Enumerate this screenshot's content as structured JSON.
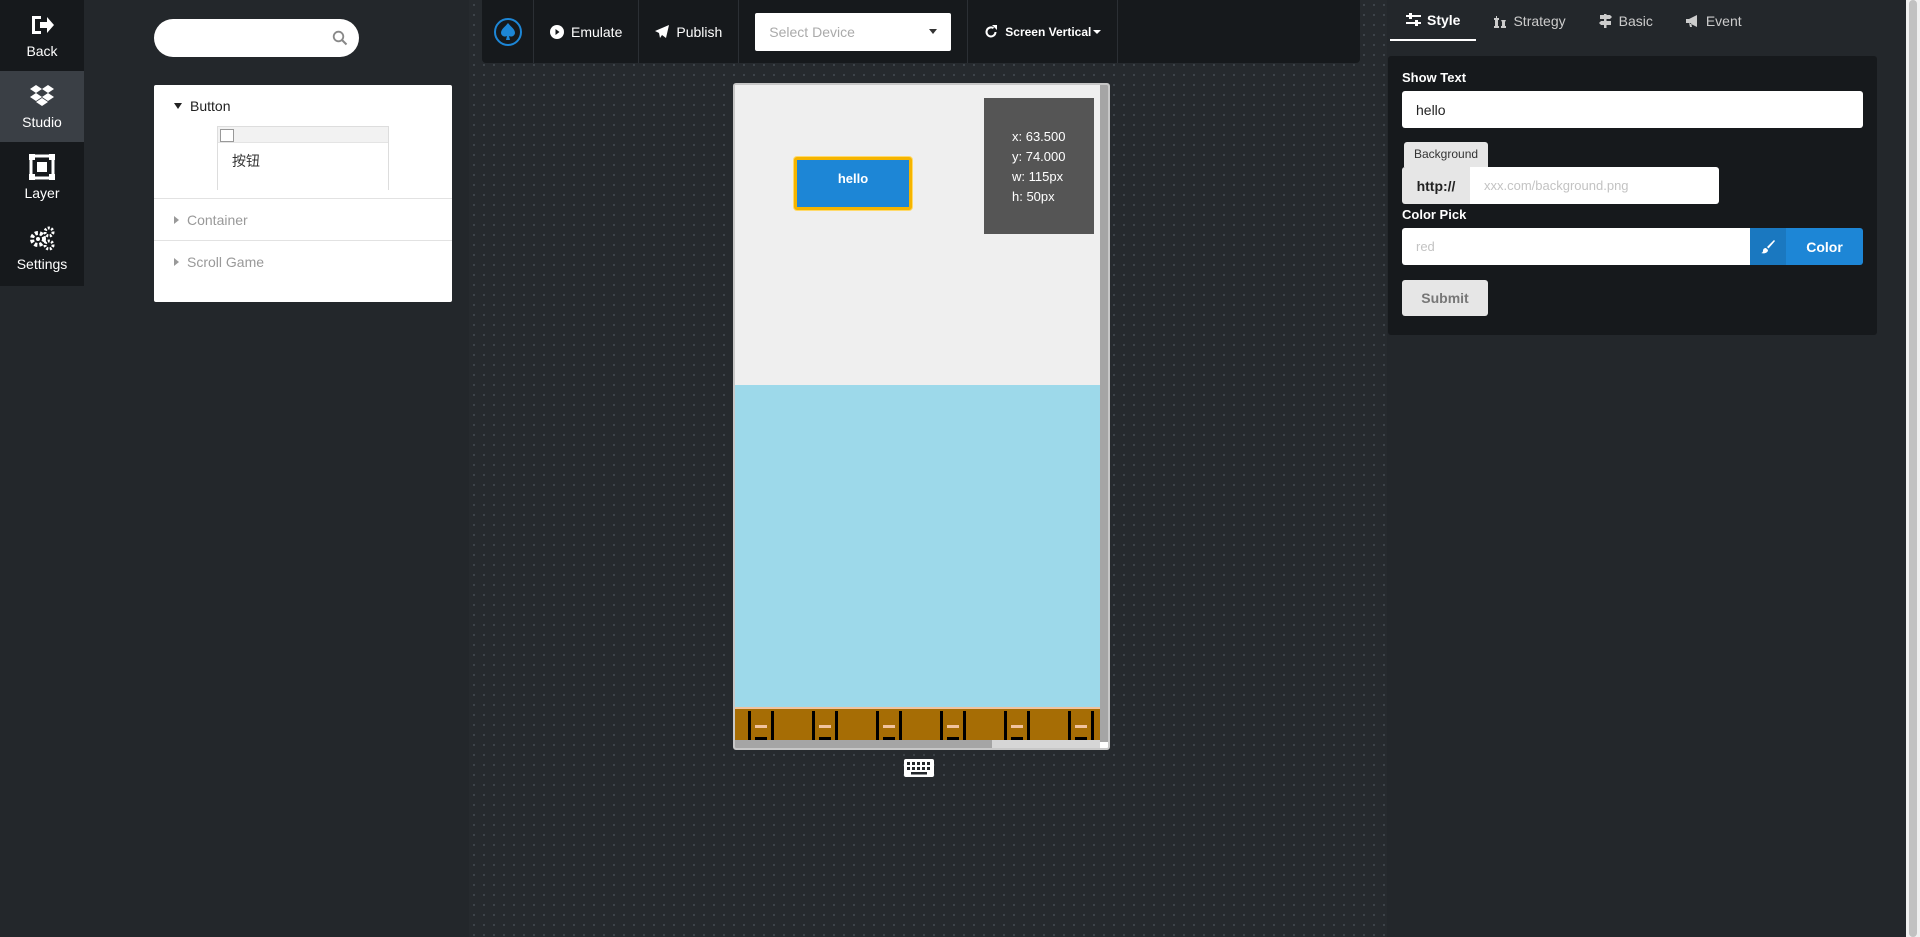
{
  "nav": {
    "back": "Back",
    "studio": "Studio",
    "layer": "Layer",
    "settings": "Settings"
  },
  "search": {
    "value": "",
    "placeholder": ""
  },
  "components": {
    "groups": [
      {
        "label": "Button",
        "expanded": true,
        "items": [
          {
            "label": "按钮"
          }
        ]
      },
      {
        "label": "Container",
        "expanded": false
      },
      {
        "label": "Scroll Game",
        "expanded": false
      }
    ]
  },
  "toolbar": {
    "emulate": "Emulate",
    "publish": "Publish",
    "device_placeholder": "Select Device",
    "screen": "Screen Vertical"
  },
  "stage": {
    "button_label": "hello",
    "coords": {
      "x": "x: 63.500",
      "y": "y: 74.000",
      "w": "w: 115px",
      "h": "h: 50px"
    }
  },
  "panel": {
    "tabs": [
      "Style",
      "Strategy",
      "Basic",
      "Event"
    ],
    "active_tab": "Style",
    "show_text_label": "Show Text",
    "show_text_value": "hello",
    "background_label": "Background",
    "url_prefix": "http://",
    "url_placeholder": "xxx.com/background.png",
    "color_label": "Color Pick",
    "color_placeholder": "red",
    "color_button": "Color",
    "submit": "Submit"
  },
  "colors": {
    "accent": "#1d86d6",
    "selection": "#f5b400",
    "sky": "#9dd9ea",
    "ground": "#a66d05"
  }
}
